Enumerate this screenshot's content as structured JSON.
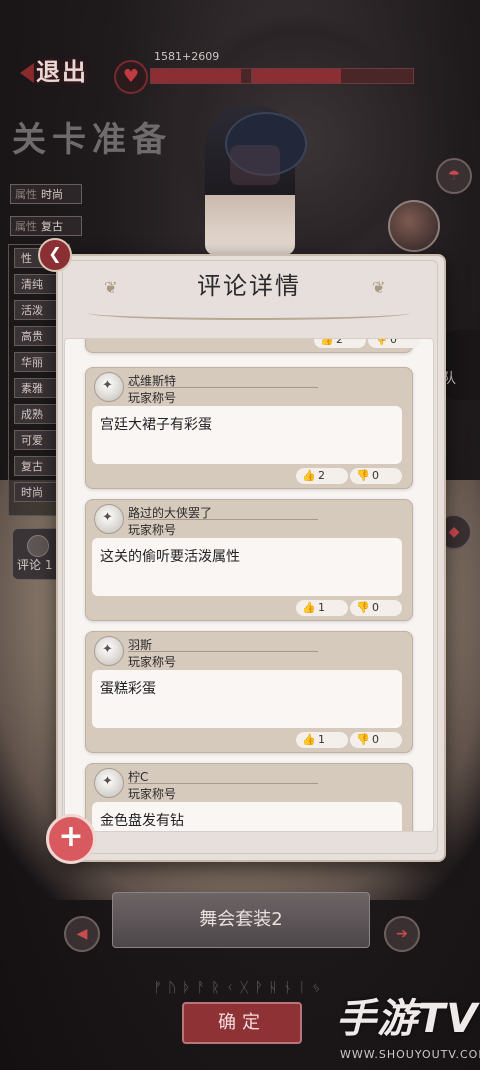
{
  "top": {
    "exit_label": "退出",
    "stage_title": "关卡准备",
    "score_text": "1581+2609",
    "progress_1": 0.9,
    "progress_2": 0.55
  },
  "left_panel": {
    "attr_key": "属性",
    "tag_1": "时尚",
    "tag_2": "复古",
    "items": [
      "性",
      "清纯",
      "活泼",
      "高贵",
      "华丽",
      "素雅",
      "成熟",
      "可爱",
      "复古",
      "时尚"
    ],
    "comment_tab": "评论 1"
  },
  "right_side": {
    "team_label": "队"
  },
  "dialog": {
    "title": "评论详情",
    "comments": [
      {
        "name": "",
        "title": "",
        "text": "",
        "likes": "2",
        "dislikes": "0"
      },
      {
        "name": "忒维斯特",
        "title": "玩家称号",
        "text": "宫廷大裙子有彩蛋",
        "likes": "2",
        "dislikes": "0"
      },
      {
        "name": "路过的大侠罢了",
        "title": "玩家称号",
        "text": "这关的偷听要活泼属性",
        "likes": "1",
        "dislikes": "0"
      },
      {
        "name": "羽斯",
        "title": "玩家称号",
        "text": "蛋糕彩蛋",
        "likes": "1",
        "dislikes": "0"
      },
      {
        "name": "柠C",
        "title": "玩家称号",
        "text": "金色盘发有钻",
        "likes": "",
        "dislikes": ""
      }
    ]
  },
  "bottom": {
    "outfit_name": "舞会套装2",
    "confirm_label": "确定"
  },
  "watermark": {
    "logo": "手游TV",
    "url": "WWW.SHOUYOUTV.COM"
  },
  "icons": {
    "heart": "heart-icon",
    "back": "back-arrow-icon",
    "add": "plus-icon",
    "like": "thumbs-up-icon",
    "dislike": "thumbs-down-icon"
  }
}
